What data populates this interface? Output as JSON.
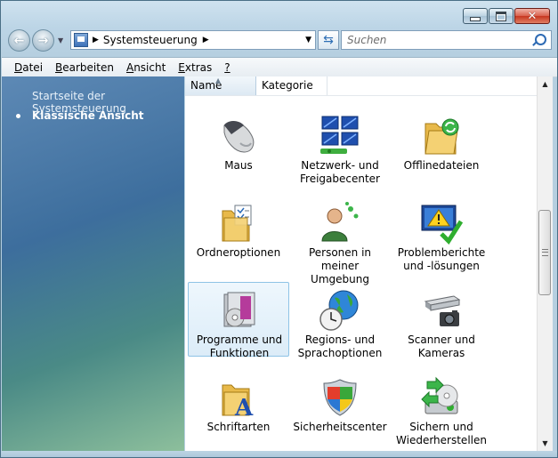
{
  "window": {
    "caption_buttons": [
      "minimize",
      "maximize",
      "close"
    ]
  },
  "navigation": {
    "address": {
      "segments": [
        "Systemsteuerung"
      ]
    },
    "search": {
      "placeholder": "Suchen"
    }
  },
  "menu": {
    "items": [
      {
        "label_underlined": "D",
        "label_rest": "atei"
      },
      {
        "label_underlined": "B",
        "label_rest": "earbeiten"
      },
      {
        "label_underlined": "A",
        "label_rest": "nsicht"
      },
      {
        "label_underlined": "E",
        "label_rest": "xtras"
      },
      {
        "label_underlined": "?",
        "label_rest": ""
      }
    ]
  },
  "sidebar": {
    "links": [
      {
        "label": "Startseite der Systemsteuerung",
        "active": false
      },
      {
        "label": "Klassische Ansicht",
        "active": true
      }
    ]
  },
  "columns": [
    "Name",
    "Kategorie"
  ],
  "items": [
    {
      "line1": "Maus",
      "line2": "",
      "icon": "mouse-icon",
      "selected": false
    },
    {
      "line1": "Netzwerk- und",
      "line2": "Freigabecenter",
      "icon": "network-icon",
      "selected": false
    },
    {
      "line1": "Offlinedateien",
      "line2": "",
      "icon": "offline-files-icon",
      "selected": false
    },
    {
      "line1": "Ordneroptionen",
      "line2": "",
      "icon": "folder-options-icon",
      "selected": false
    },
    {
      "line1": "Personen in meiner",
      "line2": "Umgebung",
      "icon": "people-icon",
      "selected": false
    },
    {
      "line1": "Problemberichte",
      "line2": "und -lösungen",
      "icon": "problem-reports-icon",
      "selected": false
    },
    {
      "line1": "Programme und",
      "line2": "Funktionen",
      "icon": "programs-icon",
      "selected": true
    },
    {
      "line1": "Regions- und",
      "line2": "Sprachoptionen",
      "icon": "globe-clock-icon",
      "selected": false
    },
    {
      "line1": "Scanner und",
      "line2": "Kameras",
      "icon": "scanner-camera-icon",
      "selected": false
    },
    {
      "line1": "Schriftarten",
      "line2": "",
      "icon": "fonts-folder-icon",
      "selected": false
    },
    {
      "line1": "Sicherheitscenter",
      "line2": "",
      "icon": "security-shield-icon",
      "selected": false
    },
    {
      "line1": "Sichern und",
      "line2": "Wiederherstellen",
      "icon": "backup-restore-icon",
      "selected": false
    }
  ],
  "scrollbar": {
    "position_fraction": 0.4
  }
}
